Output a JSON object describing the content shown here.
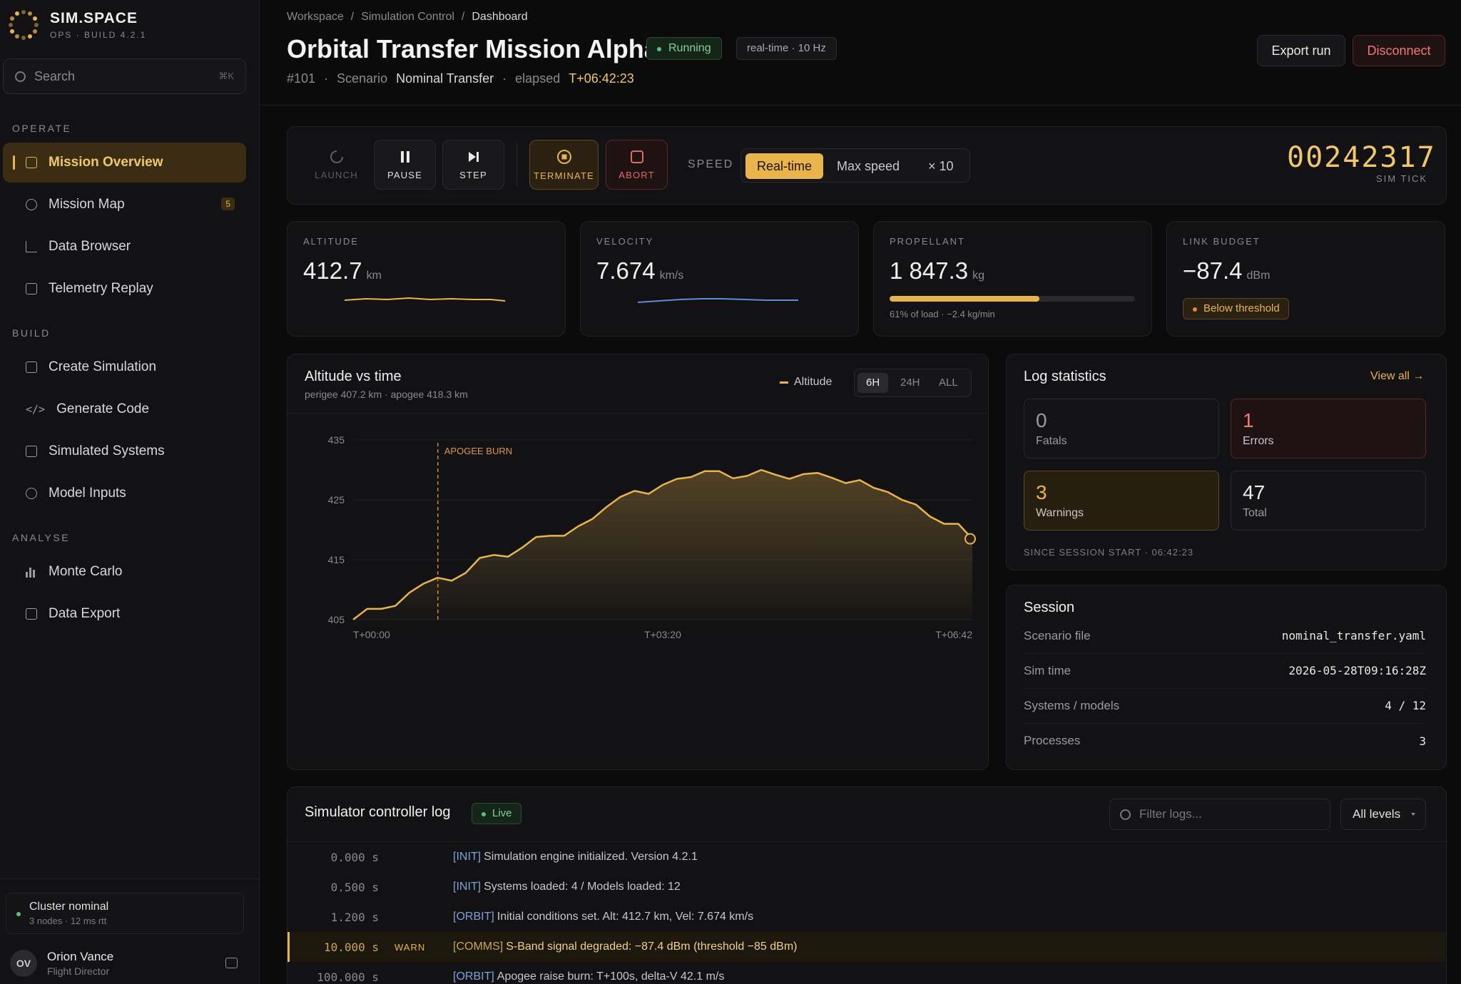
{
  "brand": {
    "name": "SIM.SPACE",
    "sub": "OPS · BUILD 4.2.1"
  },
  "search": {
    "placeholder": "Search",
    "shortcut": "⌘K"
  },
  "sidebar": {
    "sections": [
      {
        "label": "OPERATE"
      },
      {
        "label": "BUILD"
      },
      {
        "label": "ANALYSE"
      }
    ],
    "items": [
      {
        "label": "Mission Overview",
        "icon": "square-icon",
        "active": true
      },
      {
        "label": "Mission Map",
        "icon": "circle-icon",
        "badge": "5"
      },
      {
        "label": "Data Browser",
        "icon": "axis-icon"
      },
      {
        "label": "Telemetry Replay",
        "icon": "square-icon"
      },
      {
        "label": "Create Simulation",
        "icon": "square-icon"
      },
      {
        "label": "Generate Code",
        "icon": "code-icon",
        "glyph": "</>"
      },
      {
        "label": "Simulated Systems",
        "icon": "square-icon"
      },
      {
        "label": "Model Inputs",
        "icon": "circle-icon"
      },
      {
        "label": "Monte Carlo",
        "icon": "bar-chart-icon"
      },
      {
        "label": "Data Export",
        "icon": "square-icon"
      }
    ]
  },
  "cluster": {
    "title": "Cluster nominal",
    "sub": "3 nodes · 12 ms rtt"
  },
  "user": {
    "initials": "OV",
    "name": "Orion Vance",
    "role": "Flight Director"
  },
  "breadcrumb": [
    "Workspace",
    "/",
    "Simulation Control",
    "/",
    "Dashboard"
  ],
  "header": {
    "title": "Orbital Transfer Mission Alpha",
    "status": "Running",
    "rate": "real-time · 10 Hz",
    "run_id": "#101",
    "sep": "·",
    "scenario_label": "Scenario",
    "scenario": "Nominal Transfer",
    "elapsed_label": "elapsed",
    "elapsed": "T+06:42:23",
    "export_label": "Export run",
    "disconnect_label": "Disconnect"
  },
  "controls": {
    "launch": "LAUNCH",
    "pause": "PAUSE",
    "step": "STEP",
    "terminate": "TERMINATE",
    "abort": "ABORT",
    "speed_label": "SPEED",
    "speed_options": [
      "Real-time",
      "Max speed",
      "× 10"
    ],
    "tick": "00242317",
    "tick_label": "SIM TICK"
  },
  "stats": [
    {
      "label": "ALTITUDE",
      "value": "412.7",
      "unit": "km"
    },
    {
      "label": "VELOCITY",
      "value": "7.674",
      "unit": "km/s"
    },
    {
      "label": "PROPELLANT",
      "value": "1 847.3",
      "unit": "kg",
      "progress": 0.61,
      "note": "61% of load · −2.4 kg/min"
    },
    {
      "label": "LINK BUDGET",
      "value": "−87.4",
      "unit": "dBm",
      "badge": "Below threshold"
    }
  ],
  "colors": {
    "accent": "#e9b44c",
    "velocity_line": "#5b8fd6",
    "error": "#f07a72",
    "ok": "#5fbf7a"
  },
  "chart_panel": {
    "title": "Altitude vs time",
    "subtitle": "perigee 407.2 km · apogee 418.3 km",
    "legend": "Altitude",
    "ranges": [
      "6H",
      "24H",
      "ALL"
    ],
    "active_range": "6H"
  },
  "chart_data": {
    "type": "area",
    "series": [
      {
        "name": "Altitude",
        "values": [
          405.0,
          406.8,
          406.8,
          407.3,
          409.5,
          411.0,
          412.0,
          411.5,
          412.8,
          415.3,
          415.8,
          415.5,
          417.0,
          418.8,
          419.0,
          419.0,
          420.6,
          421.8,
          423.8,
          425.5,
          426.5,
          426.0,
          427.5,
          428.5,
          428.8,
          429.8,
          429.8,
          428.6,
          429.0,
          430.0,
          429.2,
          428.5,
          429.3,
          429.5,
          428.7,
          427.8,
          428.3,
          427.0,
          426.3,
          425.0,
          424.2,
          422.2,
          421.0,
          421.0,
          418.5
        ]
      }
    ],
    "x_range": [
      0,
      402
    ],
    "x_ticks": [
      "T+00:00",
      "T+03:20",
      "T+06:42"
    ],
    "y_ticks": [
      405,
      415,
      425,
      435
    ],
    "ylim": [
      405,
      435
    ],
    "annotation": {
      "label": "APOGEE BURN",
      "x": 55
    },
    "grid": true
  },
  "log_stats": {
    "title": "Log statistics",
    "view_all": "View all →",
    "fatals": "0",
    "fatals_label": "Fatals",
    "errors": "1",
    "errors_label": "Errors",
    "warnings": "3",
    "warnings_label": "Warnings",
    "total": "47",
    "total_label": "Total",
    "since": "SINCE SESSION START · 06:42:23"
  },
  "session": {
    "title": "Session",
    "rows": [
      {
        "k": "Scenario file",
        "v": "nominal_transfer.yaml"
      },
      {
        "k": "Sim time",
        "v": "2026-05-28T09:16:28Z"
      },
      {
        "k": "Systems / models",
        "v": "4 / 12"
      },
      {
        "k": "Processes",
        "v": "3"
      }
    ]
  },
  "log": {
    "title": "Simulator controller log",
    "live": "Live",
    "filter_placeholder": "Filter logs...",
    "level": "All levels",
    "rows": [
      {
        "time": "0.000 s",
        "level": "",
        "tag": "[INIT]",
        "msg": "Simulation engine initialized. Version 4.2.1"
      },
      {
        "time": "0.500 s",
        "level": "",
        "tag": "[INIT]",
        "msg": "Systems loaded: 4 / Models loaded: 12"
      },
      {
        "time": "1.200 s",
        "level": "",
        "tag": "[ORBIT]",
        "msg": "Initial conditions set. Alt: 412.7 km, Vel: 7.674 km/s"
      },
      {
        "time": "10.000 s",
        "level": "WARN",
        "tag": "[COMMS]",
        "msg": "S-Band signal degraded: −87.4 dBm (threshold −85 dBm)"
      },
      {
        "time": "100.000 s",
        "level": "",
        "tag": "[ORBIT]",
        "msg": "Apogee raise burn: T+100s, delta-V 42.1 m/s"
      }
    ]
  }
}
